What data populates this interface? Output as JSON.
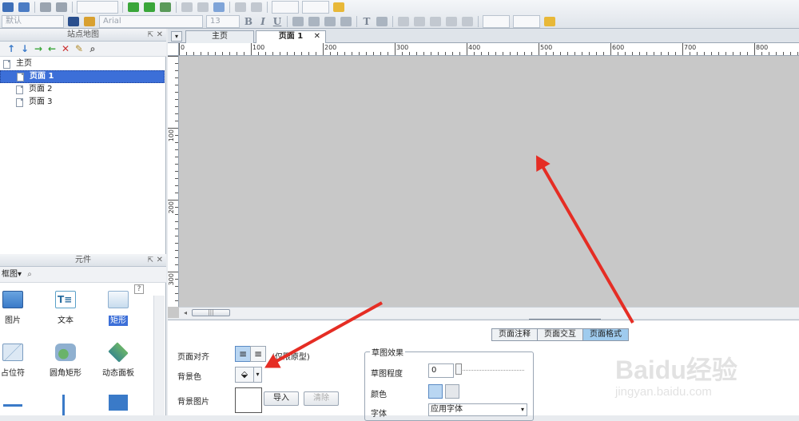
{
  "toolbar": {
    "font_style": "默认",
    "font_family": "Arial",
    "font_size": "13"
  },
  "sitemap": {
    "title": "站点地图",
    "tree": [
      {
        "label": "主页"
      },
      {
        "label": "页面 1",
        "selected": true
      },
      {
        "label": "页面 2"
      },
      {
        "label": "页面 3"
      }
    ]
  },
  "widgets": {
    "title": "元件",
    "library": "框图",
    "help": "?",
    "items": [
      {
        "label": "图片",
        "icon": "image-icon"
      },
      {
        "label": "文本",
        "icon": "text-icon"
      },
      {
        "label": "矩形",
        "icon": "rectangle-icon",
        "selected": true
      },
      {
        "label": "占位符",
        "icon": "placeholder-icon"
      },
      {
        "label": "圆角矩形",
        "icon": "rounded-rect-icon"
      },
      {
        "label": "动态面板",
        "icon": "dynamic-panel-icon"
      }
    ]
  },
  "tabs": [
    {
      "label": "主页"
    },
    {
      "label": "页面 1",
      "active": true
    }
  ],
  "rulers": {
    "top": [
      "0",
      "100",
      "200",
      "300",
      "400",
      "500",
      "600",
      "700",
      "800"
    ],
    "left": [
      "100",
      "200",
      "300"
    ]
  },
  "properties": {
    "tabs": [
      {
        "label": "页面注释"
      },
      {
        "label": "页面交互"
      },
      {
        "label": "页面格式",
        "active": true
      }
    ],
    "page_align_label": "页面对齐",
    "page_align_note": "(仅限原型)",
    "bg_color_label": "背景色",
    "bg_image_label": "背景图片",
    "import_button": "导入",
    "clear_button": "清除",
    "sketch": {
      "title": "草图效果",
      "level_label": "草图程度",
      "level_value": "0",
      "color_label": "颜色",
      "font_label": "字体",
      "font_value": "应用字体"
    }
  },
  "watermark": {
    "brand": "Baidu经验",
    "url": "jingyan.baidu.com"
  },
  "colors": {
    "selection": "#3c6fd8",
    "annotation_arrow": "#e52d24",
    "active_tab": "#9fcbee"
  }
}
